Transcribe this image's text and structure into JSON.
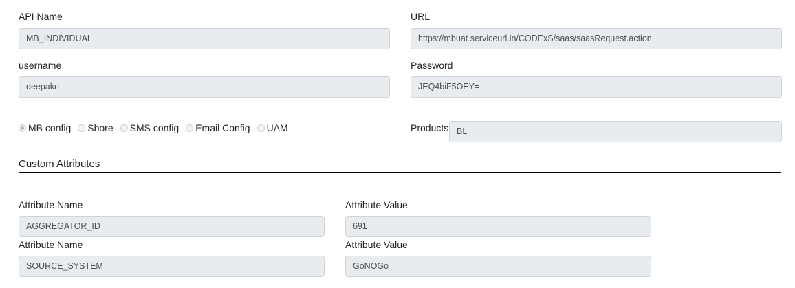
{
  "api": {
    "name_label": "API Name",
    "name_value": "MB_INDIVIDUAL",
    "url_label": "URL",
    "url_value": "https://mbuat.serviceurl.in/CODExS/saas/saasRequest.action",
    "username_label": "username",
    "username_value": "deepakn",
    "password_label": "Password",
    "password_value": "JEQ4biF5OEY="
  },
  "config": {
    "options": [
      {
        "label": "MB config",
        "selected": true
      },
      {
        "label": "Sbore",
        "selected": false
      },
      {
        "label": "SMS config",
        "selected": false
      },
      {
        "label": "Email Config",
        "selected": false
      },
      {
        "label": "UAM",
        "selected": false
      }
    ],
    "products_label": "Products",
    "products_value": "BL"
  },
  "custom": {
    "title": "Custom Attributes",
    "rows": [
      {
        "name_label": "Attribute Name",
        "name_value": "AGGREGATOR_ID",
        "value_label": "Attribute Value",
        "value": "691"
      },
      {
        "name_label": "Attribute Name",
        "name_value": "SOURCE_SYSTEM",
        "value_label": "Attribute Value",
        "value": "GoNOGo"
      }
    ]
  }
}
